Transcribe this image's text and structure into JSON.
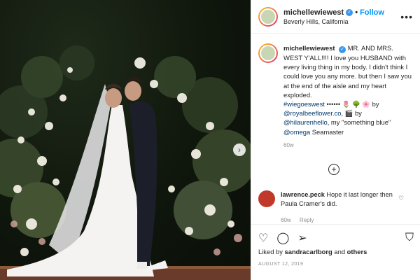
{
  "header": {
    "username": "michellewiewest",
    "follow_label": "Follow",
    "location": "Beverly Hills, California",
    "more_label": "•••"
  },
  "caption": {
    "username": "michellewiewest",
    "text_main": "MR. AND MRS. WEST Y'ALL!!!! I love you HUSBAND with every living thing in my body. I didn't think I could love you any more. but then I saw you at the end of the aisle and my heart exploded.",
    "hashtag": "#wiegoeswest",
    "emoji_line": "•••••• 🌷 🌳 🌸 by",
    "mention_1": "@royalbeeflower.co",
    "mention_1_suffix": ", 🎬 by",
    "mention_2": "@hilaurenhello",
    "mention_2_suffix": ", my \"something blue\"",
    "mention_3": "@omega",
    "mention_3_suffix": " Seamaster",
    "time": "60w"
  },
  "load_more_icon": "+",
  "comment": {
    "username": "lawrence.peck",
    "text": "Hope it last longer then Paula Cramer's did.",
    "time": "60w",
    "reply_label": "Reply"
  },
  "liked_by": {
    "prefix": "Liked by ",
    "user": "sandracarlborg",
    "middle": " and ",
    "others": "others"
  },
  "date": "AUGUST 12, 2019",
  "icons": {
    "heart": "heart-icon",
    "comment": "comment-icon",
    "share": "share-icon",
    "bookmark": "bookmark-icon",
    "next": "chevron-right-icon",
    "verified": "verified-badge-icon"
  },
  "colors": {
    "link": "#00376b",
    "follow": "#0095f6",
    "verified": "#3897f0"
  }
}
